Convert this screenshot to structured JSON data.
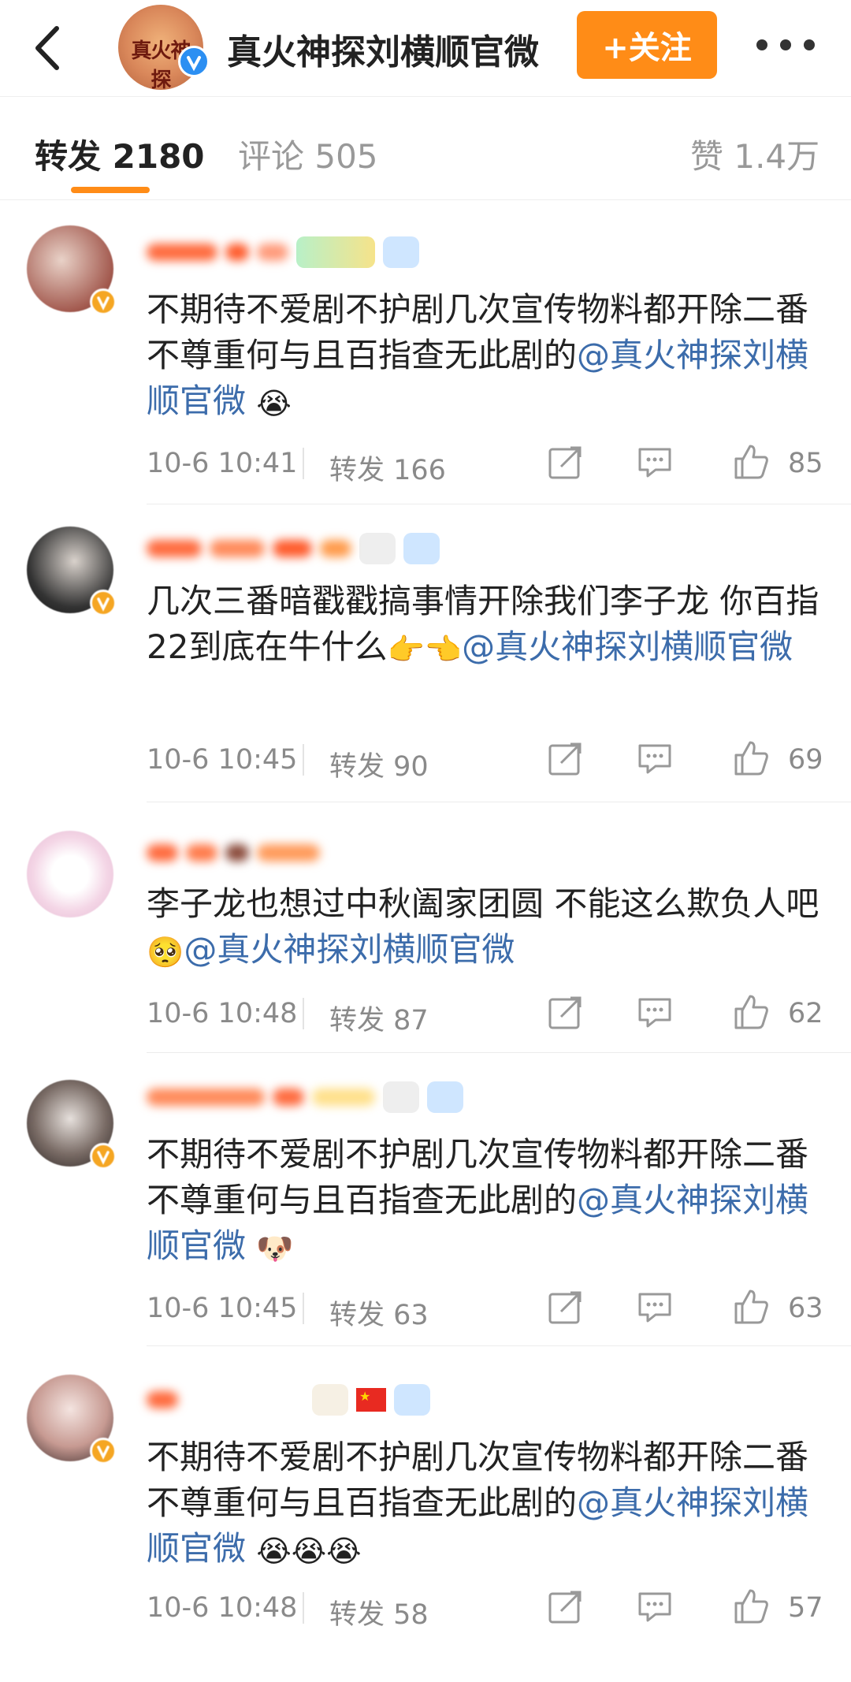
{
  "header": {
    "title": "真火神探刘横顺官微",
    "avatar_text": "真火神探",
    "follow_label": "+关注",
    "back_icon": "chevron-left-icon",
    "more_icon": "more-dots-icon",
    "accent_color": "#ff8c17"
  },
  "tabs": [
    {
      "label": "转发 2180",
      "active": true
    },
    {
      "label": "评论 505",
      "active": false
    },
    {
      "label": "赞 1.4万",
      "active": false
    }
  ],
  "comments": [
    {
      "text": "不期待不爱剧不护剧几次宣传物料都开除二番不尊重何与且百指查无此剧的",
      "mention": "@真火神探刘横顺官微",
      "emoji": "😭",
      "time": "10-6 10:41",
      "repost_label": "转发 166",
      "likes": "85",
      "verified": "orange"
    },
    {
      "text": "几次三番暗戳戳搞事情开除我们李子龙 你百指22到底在牛什么",
      "mention": "@真火神探刘横顺官微",
      "emoji": "👉👈",
      "time": "10-6 10:45",
      "repost_label": "转发 90",
      "likes": "69",
      "verified": "orange"
    },
    {
      "text": "李子龙也想过中秋阖家团圆 不能这么欺负人吧",
      "mention": "@真火神探刘横顺官微",
      "emoji": "🥺",
      "time": "10-6 10:48",
      "repost_label": "转发 87",
      "likes": "62",
      "verified": "none"
    },
    {
      "text": "不期待不爱剧不护剧几次宣传物料都开除二番不尊重何与且百指查无此剧的",
      "mention": "@真火神探刘横顺官微",
      "emoji": "🐶",
      "time": "10-6 10:45",
      "repost_label": "转发 63",
      "likes": "63",
      "verified": "orange"
    },
    {
      "text": "不期待不爱剧不护剧几次宣传物料都开除二番不尊重何与且百指查无此剧的",
      "mention": "@真火神探刘横顺官微",
      "emoji": "😭😭😭",
      "time": "10-6 10:48",
      "repost_label": "转发 58",
      "likes": "57",
      "verified": "orange"
    }
  ]
}
